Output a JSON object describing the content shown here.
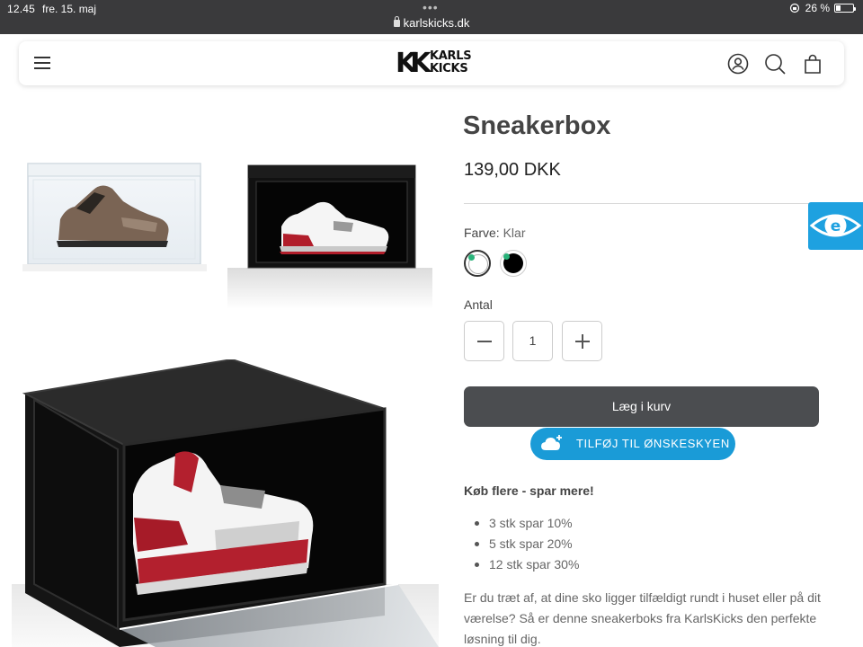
{
  "status_bar": {
    "time": "12.45",
    "date": "fre. 15. maj",
    "url": "karlskicks.dk",
    "battery": "26 %"
  },
  "header": {
    "logo_mark": "KK",
    "logo_line1": "KARLS",
    "logo_line2": "KICKS",
    "icons": [
      "menu-icon",
      "account-icon",
      "search-icon",
      "bag-icon"
    ]
  },
  "product": {
    "title": "Sneakerbox",
    "price": "139,00 DKK",
    "color_label": "Farve:",
    "color_value": "Klar",
    "swatches": [
      "Klar",
      "Sort"
    ],
    "quantity_label": "Antal",
    "quantity": "1",
    "add_to_cart": "Læg i kurv",
    "wishlist": "TILFØJ TIL ØNSKESKYEN",
    "promo_title": "Køb flere - spar mere!",
    "promos": [
      "3 stk spar 10%",
      "5 stk spar 20%",
      "12 stk spar 30%"
    ],
    "description": "Er du træt af, at dine sko ligger tilfældigt rundt i huset eller på dit værelse? Så er denne sneakerboks fra KarlsKicks den perfekte løsning til dig."
  },
  "colors": {
    "status_bg": "#3a3a3c",
    "cart_button": "#4b4d50",
    "wishlist_button": "#1a9bd7",
    "e_badge": "#1ea1e0",
    "swatch_dot": "#29b37a"
  }
}
